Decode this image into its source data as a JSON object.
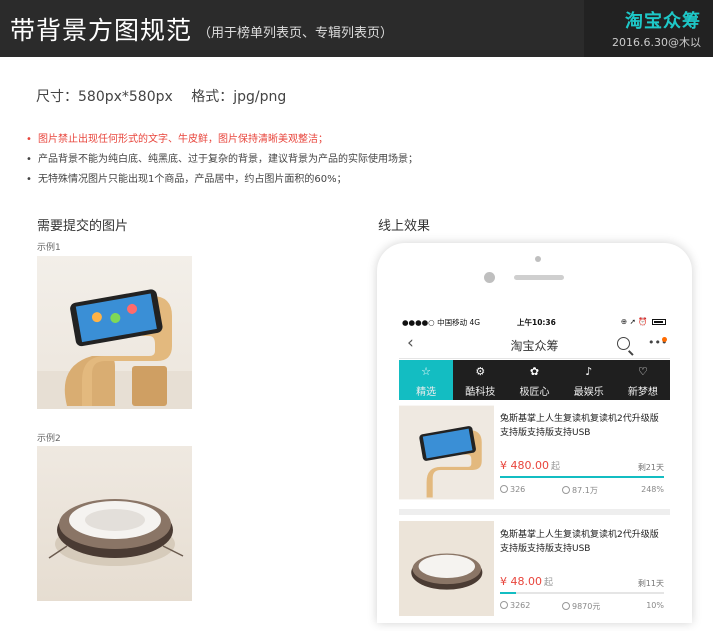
{
  "header": {
    "title": "带背景方图规范",
    "subtitle": "（用于榜单列表页、专辑列表页）",
    "brand": "淘宝众筹",
    "date": "2016.6.30@木以"
  },
  "spec": {
    "size": "尺寸：580px*580px",
    "format": "格式：jpg/png"
  },
  "rules": [
    "图片禁止出现任何形式的文字、牛皮鲜，图片保持清晰美观整洁；",
    "产品背景不能为纯白底、纯黑底、过于复杂的背景，建议背景为产品的实际使用场景；",
    "无特殊情况图片只能出现1个商品，产品居中，约占图片面积的60%；"
  ],
  "sections": {
    "submit_title": "需要提交的图片",
    "online_title": "线上效果",
    "example1": "示例1",
    "example2": "示例2"
  },
  "colors": {
    "accent": "#13bdc2",
    "warn": "#e8453c",
    "header_bg": "#2b2b2b"
  },
  "phone": {
    "status": {
      "carrier": "●●●●○ 中国移动  4G",
      "time": "上午10:36",
      "icons": "⊕ ➚ ⏰"
    },
    "nav": {
      "back": "‹",
      "title": "淘宝众筹",
      "more": "•••"
    },
    "tabs": [
      {
        "label": "精选",
        "icon": "star-icon",
        "glyph": "☆",
        "active": true
      },
      {
        "label": "酷科技",
        "icon": "tech-icon",
        "glyph": "⚙",
        "active": false
      },
      {
        "label": "极匠心",
        "icon": "craft-icon",
        "glyph": "✿",
        "active": false
      },
      {
        "label": "最娱乐",
        "icon": "entertainment-icon",
        "glyph": "♪",
        "active": false
      },
      {
        "label": "新梦想",
        "icon": "dream-icon",
        "glyph": "♡",
        "active": false
      }
    ],
    "cards": [
      {
        "title": "兔斯基掌上人生复读机复读机2代升级版支持版支持版支持USB",
        "price": "¥ 480.00",
        "price_unit": "起",
        "remain": "剩21天",
        "supporters": "326",
        "raised": "87.1万",
        "percent": "248%",
        "progress": 1.0
      },
      {
        "title": "兔斯基掌上人生复读机复读机2代升级版支持版支持版支持USB",
        "price": "¥ 48.00",
        "price_unit": "起",
        "remain": "剩11天",
        "supporters": "3262",
        "raised": "9870元",
        "percent": "10%",
        "progress": 0.1
      }
    ]
  }
}
